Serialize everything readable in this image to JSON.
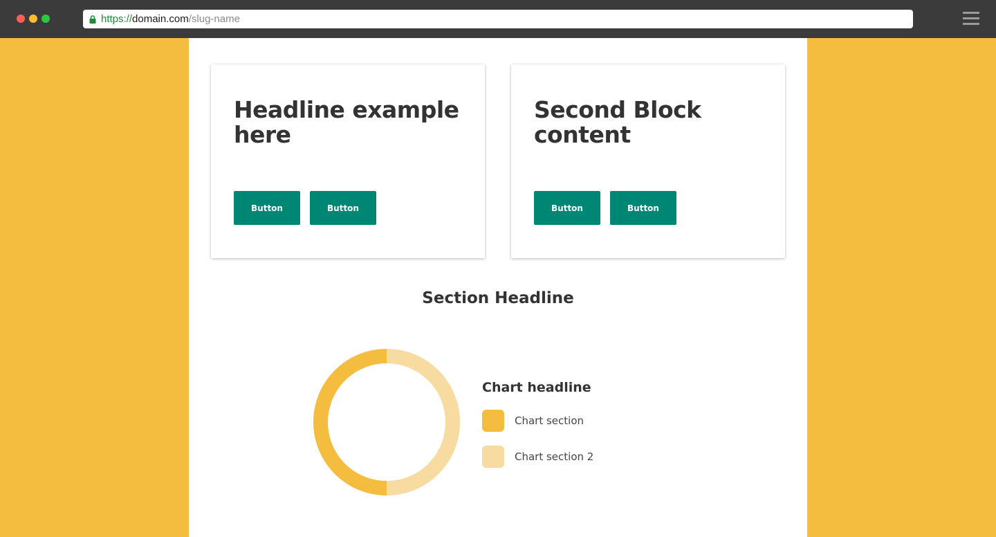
{
  "browser": {
    "url_scheme": "https://",
    "url_host": "domain.com",
    "url_path": "/slug-name",
    "traffic_colors": {
      "close": "#ff5f57",
      "minimize": "#febc2e",
      "maximize": "#28c840"
    }
  },
  "colors": {
    "background": "#f4bd40",
    "accent": "#008774",
    "chart_primary": "#f4bd40",
    "chart_secondary": "#f7dba0"
  },
  "cards": [
    {
      "title": "Headline example here",
      "buttons": [
        "Button",
        "Button"
      ]
    },
    {
      "title": "Second Block content",
      "buttons": [
        "Button",
        "Button"
      ]
    }
  ],
  "section": {
    "headline": "Section Headline"
  },
  "chart_data": {
    "type": "pie",
    "title": "Chart headline",
    "donut": true,
    "series": [
      {
        "name": "Chart section",
        "value": 50,
        "color": "#f4bd40"
      },
      {
        "name": "Chart section 2",
        "value": 50,
        "color": "#f7dba0"
      }
    ],
    "legend_position": "right"
  }
}
